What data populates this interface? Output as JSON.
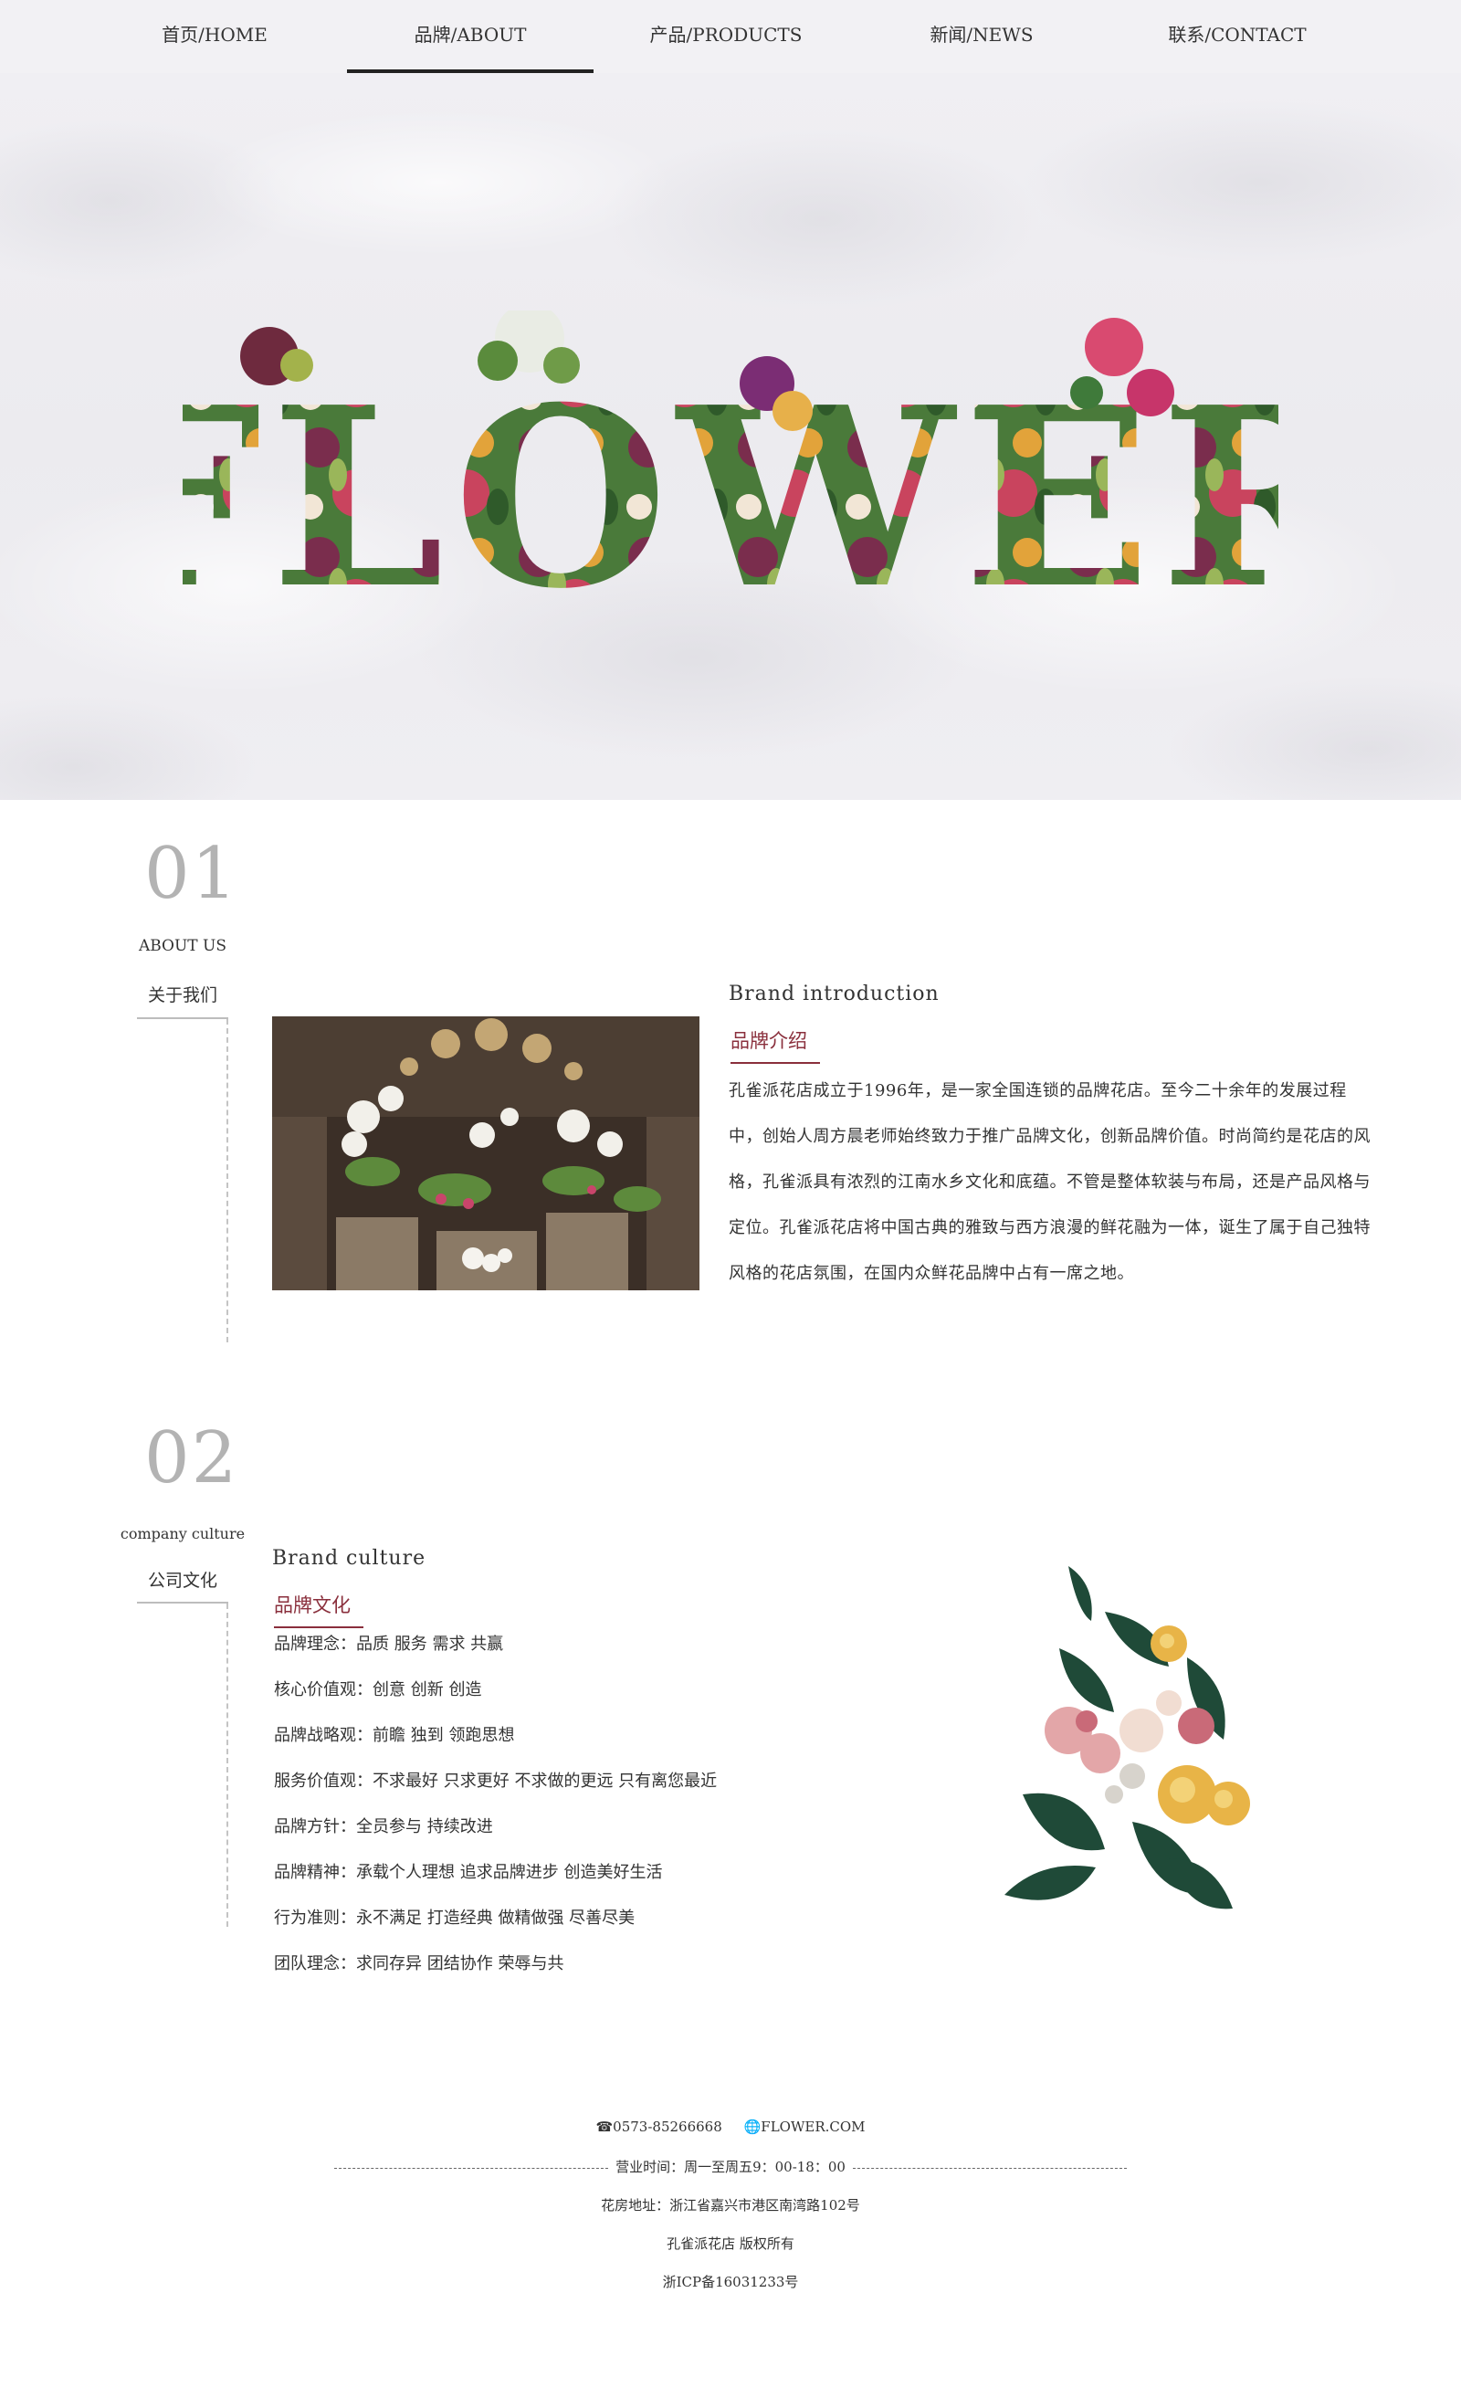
{
  "nav": {
    "items": [
      {
        "label": "首页/HOME"
      },
      {
        "label": "品牌/ABOUT"
      },
      {
        "label": "产品/PRODUCTS"
      },
      {
        "label": "新闻/NEWS"
      },
      {
        "label": "联系/CONTACT"
      }
    ],
    "active_index": 1
  },
  "hero": {
    "word": "FLOWER"
  },
  "about": {
    "number": "01",
    "en_label": "ABOUT US",
    "cn_label": "关于我们",
    "title_en": "Brand introduction",
    "title_cn": "品牌介绍",
    "text": "孔雀派花店成立于1996年，是一家全国连锁的品牌花店。至今二十余年的发展过程中，创始人周方晨老师始终致力于推广品牌文化，创新品牌价值。时尚简约是花店的风格，孔雀派具有浓烈的江南水乡文化和底蕴。不管是整体软装与布局，还是产品风格与定位。孔雀派花店将中国古典的雅致与西方浪漫的鲜花融为一体，诞生了属于自己独特风格的花店氛围，在国内众鲜花品牌中占有一席之地。"
  },
  "culture": {
    "number": "02",
    "en_label": "company culture",
    "cn_label": "公司文化",
    "title_en": "Brand culture",
    "title_cn": "品牌文化",
    "items": [
      "品牌理念：品质 服务 需求 共赢",
      "核心价值观：创意 创新 创造",
      "品牌战略观：前瞻 独到 领跑思想",
      "服务价值观：不求最好 只求更好 不求做的更远 只有离您最近",
      "品牌方针：全员参与 持续改进",
      "品牌精神：承载个人理想 追求品牌进步 创造美好生活",
      "行为准则：永不满足 打造经典 做精做强 尽善尽美",
      "团队理念：求同存异 团结协作 荣辱与共"
    ]
  },
  "footer": {
    "phone": "0573-85266668",
    "site": "FLOWER.COM",
    "hours": "营业时间：周一至周五9：00-18：00",
    "address": "花房地址：浙江省嘉兴市港区南湾路102号",
    "copyright": "孔雀派花店 版权所有",
    "icp": "浙ICP备16031233号"
  },
  "colors": {
    "accent": "#8a2f3c",
    "nav_bg": "#f2f1f4",
    "number_gray": "#b3b3b3"
  }
}
